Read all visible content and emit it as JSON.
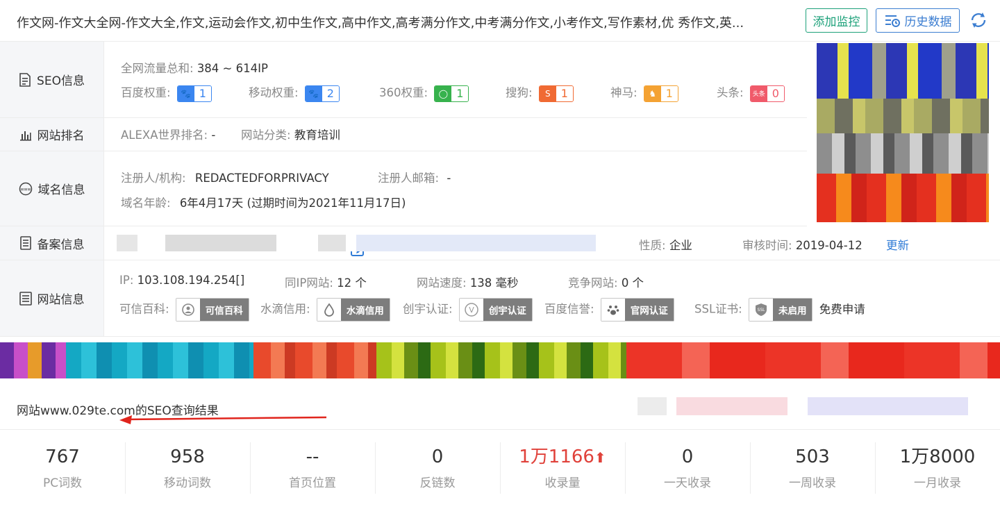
{
  "header": {
    "site_title": "作文网-作文大全网-作文大全,作文,运动会作文,初中生作文,高中作文,高考满分作文,中考满分作文,小考作文,写作素材,优 秀作文,英...",
    "add_monitor": "添加监控",
    "history": "历史数据"
  },
  "seo": {
    "label": "SEO信息",
    "traffic_label": "全网流量总和:",
    "traffic_value": "384 ~ 614IP",
    "weights": [
      {
        "label": "百度权重:",
        "value": "1",
        "color": "#3b86f0",
        "icon": "baidu-paw-icon"
      },
      {
        "label": "移动权重:",
        "value": "2",
        "color": "#3b86f0",
        "icon": "baidu-paw-icon"
      },
      {
        "label": "360权重:",
        "value": "1",
        "color": "#37b24d",
        "icon": "360-icon"
      },
      {
        "label": "搜狗:",
        "value": "1",
        "color": "#f06a33",
        "icon": "sogou-icon"
      },
      {
        "label": "神马:",
        "value": "1",
        "color": "#f4a233",
        "icon": "shenma-icon"
      },
      {
        "label": "头条:",
        "value": "0",
        "color": "#f05a6a",
        "icon": "toutiao-icon"
      }
    ]
  },
  "rank": {
    "label": "网站排名",
    "alexa_label": "ALEXA世界排名:",
    "alexa_value": "-",
    "category_label": "网站分类:",
    "category_value": "教育培训"
  },
  "domain": {
    "label": "域名信息",
    "registrant_label": "注册人/机构:",
    "registrant_value": "REDACTEDFORPRIVACY",
    "email_label": "注册人邮箱:",
    "email_value": "-",
    "age_label": "域名年龄:",
    "age_value": "6年4月17天 (过期时间为2021年11月17日)"
  },
  "icp": {
    "label": "备案信息",
    "nature_label": "性质:",
    "nature_value": "企业",
    "review_label": "审核时间:",
    "review_value": "2019-04-12",
    "update_link": "更新"
  },
  "siteinfo": {
    "label": "网站信息",
    "ip_label": "IP:",
    "ip_value": "103.108.194.254[]",
    "same_ip_label": "同IP网站:",
    "same_ip_value": "12 个",
    "speed_label": "网站速度:",
    "speed_value": "138 毫秒",
    "competitor_label": "竞争网站:",
    "competitor_value": "0 个",
    "certs": [
      {
        "label": "可信百科:",
        "badge": "可信百科",
        "icon": "shield-person-icon"
      },
      {
        "label": "水滴信用:",
        "badge": "水滴信用",
        "icon": "water-drop-icon"
      },
      {
        "label": "创宇认证:",
        "badge": "创宇认证",
        "icon": "v-shield-icon"
      },
      {
        "label": "百度信誉:",
        "badge": "官网认证",
        "icon": "baidu-paw-icon"
      },
      {
        "label": "SSL证书:",
        "badge": "未启用",
        "icon": "ssl-shield-icon"
      }
    ],
    "free_apply": "免费申请"
  },
  "result_title": "网站www.029te.com的SEO查询结果",
  "stats": [
    {
      "value": "767",
      "label": "PC词数"
    },
    {
      "value": "958",
      "label": "移动词数"
    },
    {
      "value": "--",
      "label": "首页位置"
    },
    {
      "value": "0",
      "label": "反链数"
    },
    {
      "value": "1万1166",
      "label": "收录量",
      "highlight": true
    },
    {
      "value": "0",
      "label": "一天收录"
    },
    {
      "value": "503",
      "label": "一周收录"
    },
    {
      "value": "1万8000",
      "label": "一月收录"
    }
  ],
  "colors": {
    "green": "#1da17a",
    "blue": "#3c7ed1",
    "red": "#e0413a"
  }
}
